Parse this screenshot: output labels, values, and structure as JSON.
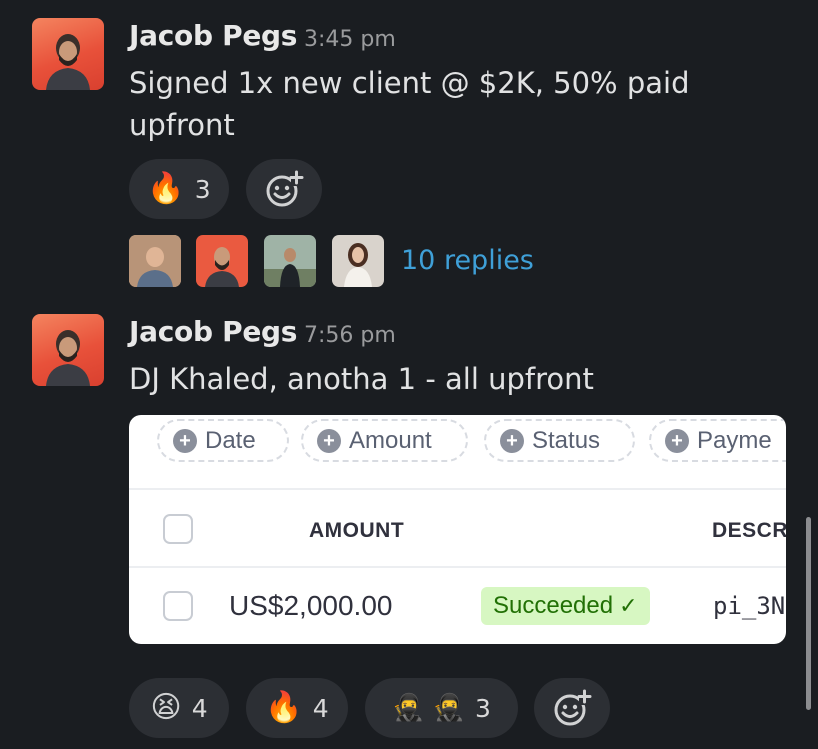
{
  "messages": [
    {
      "author": "Jacob Pegs",
      "time": "3:45 pm",
      "text": "Signed 1x new client @ $2K, 50% paid upfront",
      "text_line1": "Signed 1x new client @ $2K, 50% paid",
      "text_line2": "upfront",
      "reactions": [
        {
          "emoji": "🔥",
          "count": "3"
        }
      ],
      "thread": {
        "replies_label": "10 replies"
      }
    },
    {
      "author": "Jacob Pegs",
      "time": "7:56 pm",
      "text": "DJ Khaled, anotha 1 - all upfront",
      "attachment": {
        "filters": [
          "Date",
          "Amount",
          "Status",
          "Payme"
        ],
        "columns": [
          "AMOUNT",
          "DESCR"
        ],
        "row": {
          "amount": "US$2,000.00",
          "status": "Succeeded",
          "description": "pi_3N"
        }
      },
      "reactions": [
        {
          "emoji": "😫",
          "count": "4"
        },
        {
          "emoji": "🔥",
          "count": "4"
        },
        {
          "emoji": "🥷 🥷",
          "count": "3"
        }
      ]
    }
  ],
  "icons": {
    "add_reaction": "add-reaction-icon",
    "plus": "+",
    "check": "✓"
  },
  "colors": {
    "background": "#1a1d21",
    "link": "#3fa0d8",
    "status_bg": "#d7f7c2",
    "status_fg": "#217005"
  }
}
